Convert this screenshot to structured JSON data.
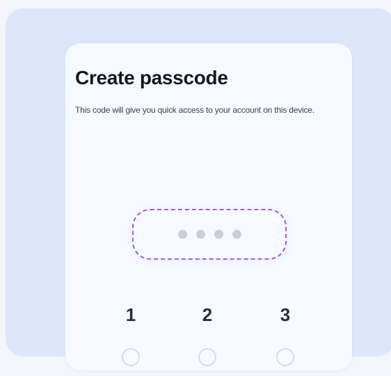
{
  "screen": {
    "title": "Create passcode",
    "subtitle": "This code will give you quick access to your account on this device."
  },
  "passcode": {
    "entered_count": 0,
    "length": 4
  },
  "keypad": {
    "row1": [
      "1",
      "2",
      "3"
    ]
  },
  "colors": {
    "accent": "#9b5de5",
    "panel_background": "#dde7fb",
    "card_background": "#f6f9ff"
  }
}
